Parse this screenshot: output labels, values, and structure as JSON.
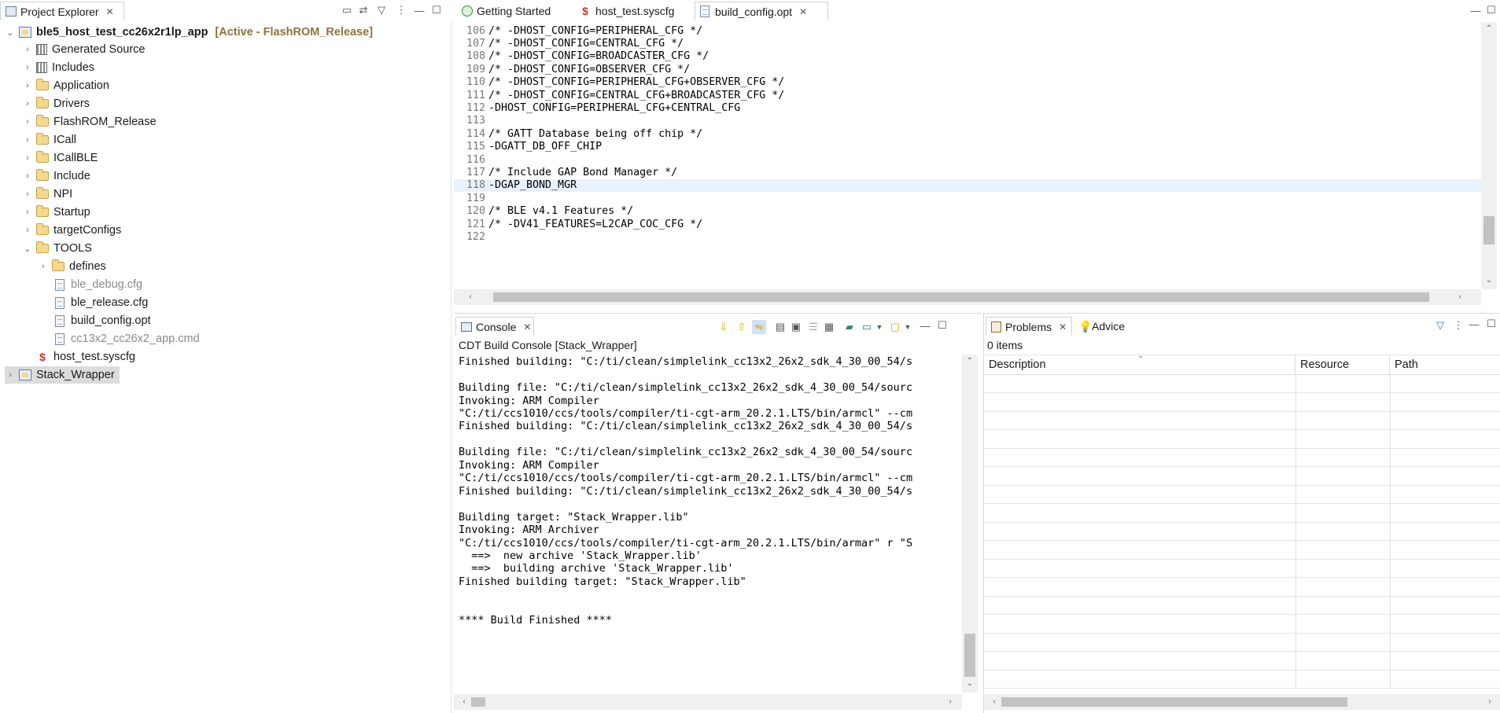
{
  "explorer": {
    "tab_label": "Project Explorer",
    "project_name": "ble5_host_test_cc26x2r1lp_app",
    "project_status": "[Active - FlashROM_Release]",
    "items": [
      {
        "label": "Generated Source",
        "icon": "include-icon"
      },
      {
        "label": "Includes",
        "icon": "include-icon"
      },
      {
        "label": "Application",
        "icon": "folder-icon"
      },
      {
        "label": "Drivers",
        "icon": "folder-icon"
      },
      {
        "label": "FlashROM_Release",
        "icon": "folder-icon"
      },
      {
        "label": "ICall",
        "icon": "folder-icon"
      },
      {
        "label": "ICallBLE",
        "icon": "folder-icon"
      },
      {
        "label": "Include",
        "icon": "folder-icon"
      },
      {
        "label": "NPI",
        "icon": "folder-icon"
      },
      {
        "label": "Startup",
        "icon": "folder-icon"
      },
      {
        "label": "targetConfigs",
        "icon": "folder-icon"
      },
      {
        "label": "TOOLS",
        "icon": "folder-icon"
      },
      {
        "label": "defines",
        "icon": "folder-icon"
      },
      {
        "label": "ble_debug.cfg",
        "icon": "file-icon"
      },
      {
        "label": "ble_release.cfg",
        "icon": "file-icon"
      },
      {
        "label": "build_config.opt",
        "icon": "file-icon"
      },
      {
        "label": "cc13x2_cc26x2_app.cmd",
        "icon": "file-icon"
      },
      {
        "label": "host_test.syscfg",
        "icon": "syscfg-icon"
      }
    ],
    "stack_project": "Stack_Wrapper"
  },
  "editor": {
    "tabs": [
      "Getting Started",
      "host_test.syscfg",
      "build_config.opt"
    ],
    "active_tab": "build_config.opt",
    "lines": [
      {
        "n": "106",
        "t": "/* -DHOST_CONFIG=PERIPHERAL_CFG */"
      },
      {
        "n": "107",
        "t": "/* -DHOST_CONFIG=CENTRAL_CFG */"
      },
      {
        "n": "108",
        "t": "/* -DHOST_CONFIG=BROADCASTER_CFG */"
      },
      {
        "n": "109",
        "t": "/* -DHOST_CONFIG=OBSERVER_CFG */"
      },
      {
        "n": "110",
        "t": "/* -DHOST_CONFIG=PERIPHERAL_CFG+OBSERVER_CFG */"
      },
      {
        "n": "111",
        "t": "/* -DHOST_CONFIG=CENTRAL_CFG+BROADCASTER_CFG */"
      },
      {
        "n": "112",
        "t": "-DHOST_CONFIG=PERIPHERAL_CFG+CENTRAL_CFG"
      },
      {
        "n": "113",
        "t": ""
      },
      {
        "n": "114",
        "t": "/* GATT Database being off chip */"
      },
      {
        "n": "115",
        "t": "-DGATT_DB_OFF_CHIP"
      },
      {
        "n": "116",
        "t": ""
      },
      {
        "n": "117",
        "t": "/* Include GAP Bond Manager */"
      },
      {
        "n": "118",
        "t": "-DGAP_BOND_MGR"
      },
      {
        "n": "119",
        "t": ""
      },
      {
        "n": "120",
        "t": "/* BLE v4.1 Features */"
      },
      {
        "n": "121",
        "t": "/* -DV41_FEATURES=L2CAP_COC_CFG */"
      },
      {
        "n": "122",
        "t": ""
      }
    ],
    "highlighted_line": "118"
  },
  "console": {
    "tab_label": "Console",
    "subtitle": "CDT Build Console [Stack_Wrapper]",
    "lines": [
      "Finished building: \"C:/ti/clean/simplelink_cc13x2_26x2_sdk_4_30_00_54/s",
      "",
      "Building file: \"C:/ti/clean/simplelink_cc13x2_26x2_sdk_4_30_00_54/sourc",
      "Invoking: ARM Compiler",
      "\"C:/ti/ccs1010/ccs/tools/compiler/ti-cgt-arm_20.2.1.LTS/bin/armcl\" --cm",
      "Finished building: \"C:/ti/clean/simplelink_cc13x2_26x2_sdk_4_30_00_54/s",
      "",
      "Building file: \"C:/ti/clean/simplelink_cc13x2_26x2_sdk_4_30_00_54/sourc",
      "Invoking: ARM Compiler",
      "\"C:/ti/ccs1010/ccs/tools/compiler/ti-cgt-arm_20.2.1.LTS/bin/armcl\" --cm",
      "Finished building: \"C:/ti/clean/simplelink_cc13x2_26x2_sdk_4_30_00_54/s",
      "",
      "Building target: \"Stack_Wrapper.lib\"",
      "Invoking: ARM Archiver",
      "\"C:/ti/ccs1010/ccs/tools/compiler/ti-cgt-arm_20.2.1.LTS/bin/armar\" r \"S",
      "  ==>  new archive 'Stack_Wrapper.lib'",
      "  ==>  building archive 'Stack_Wrapper.lib'",
      "Finished building target: \"Stack_Wrapper.lib\"",
      "",
      "",
      "**** Build Finished ****"
    ]
  },
  "problems": {
    "tab_label": "Problems",
    "advice_label": "Advice",
    "count": "0 items",
    "columns": [
      "Description",
      "Resource",
      "Path"
    ]
  }
}
